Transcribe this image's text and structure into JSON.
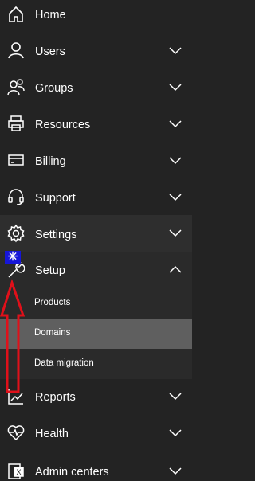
{
  "nav": {
    "home": {
      "label": "Home",
      "icon": "home-icon"
    },
    "users": {
      "label": "Users",
      "icon": "user-icon"
    },
    "groups": {
      "label": "Groups",
      "icon": "groups-icon"
    },
    "resources": {
      "label": "Resources",
      "icon": "printer-icon"
    },
    "billing": {
      "label": "Billing",
      "icon": "credit-card-icon"
    },
    "support": {
      "label": "Support",
      "icon": "headset-icon"
    },
    "settings": {
      "label": "Settings",
      "icon": "gear-icon"
    },
    "setup": {
      "label": "Setup",
      "icon": "wrench-icon",
      "expanded": true,
      "subitems": [
        {
          "label": "Products"
        },
        {
          "label": "Domains",
          "selected": true
        },
        {
          "label": "Data migration"
        }
      ]
    },
    "reports": {
      "label": "Reports",
      "icon": "chart-icon"
    },
    "health": {
      "label": "Health",
      "icon": "heart-pulse-icon"
    },
    "admin_centers": {
      "label": "Admin centers",
      "icon": "admin-centers-icon"
    }
  },
  "annotation": {
    "badge_icon": "asterisk-badge-icon",
    "arrow_color": "#e0101a"
  },
  "colors": {
    "background": "#232323",
    "selected": "#5f5f5f",
    "badge": "#1616d8"
  }
}
